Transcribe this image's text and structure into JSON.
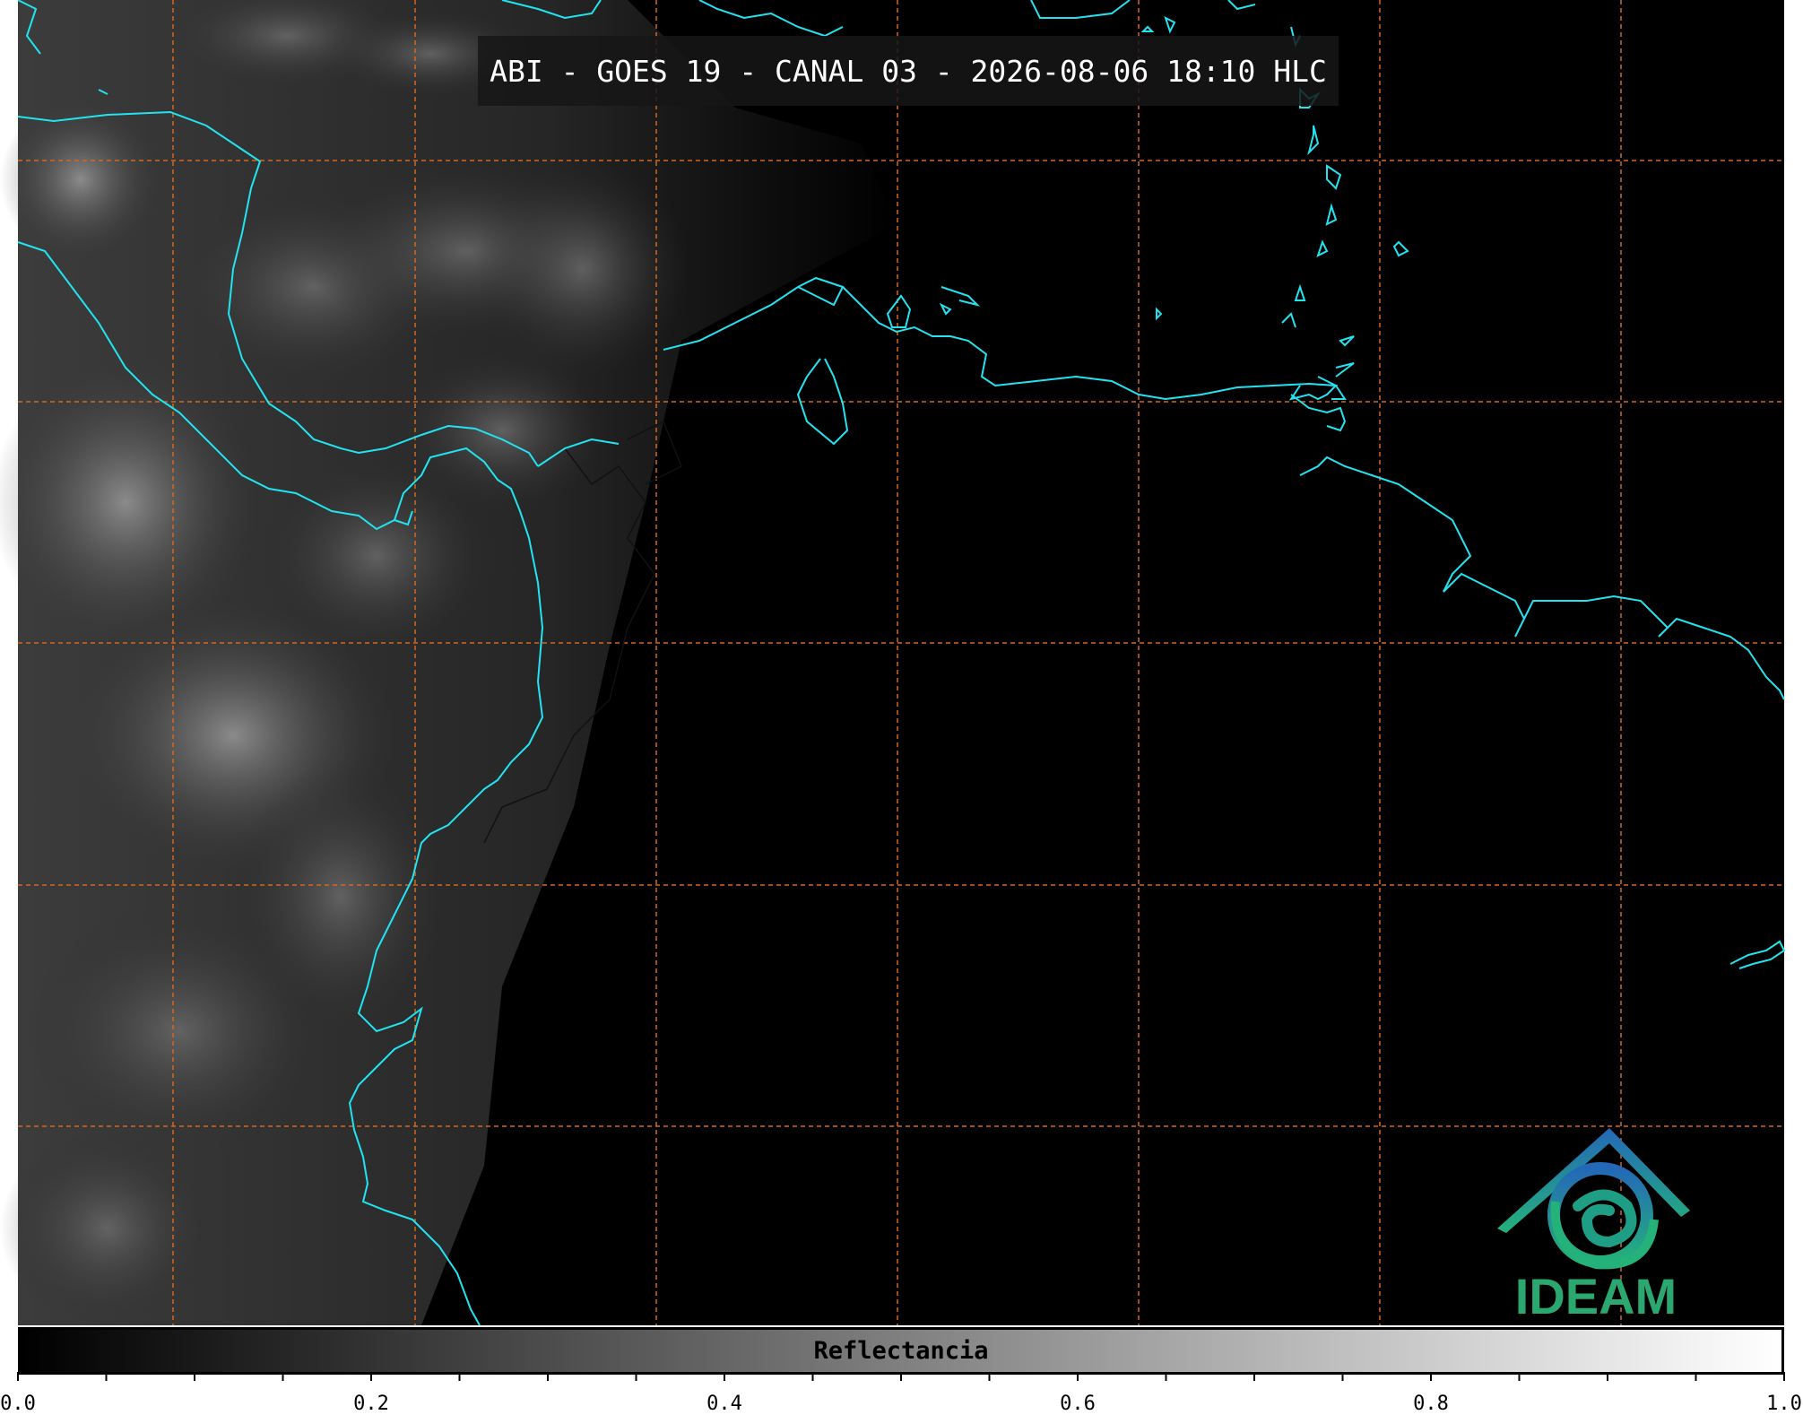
{
  "title": "ABI - GOES 19 - CANAL 03 - 2026-08-06 18:10 HLC",
  "colorbar": {
    "label": "Reflectancia",
    "ticks": [
      "0.0",
      "0.2",
      "0.4",
      "0.6",
      "0.8",
      "1.0"
    ],
    "range": [
      0.0,
      1.0
    ],
    "colormap": [
      "#000000",
      "#ffffff"
    ]
  },
  "logo": {
    "text": "IDEAM",
    "color": "#2aa86f",
    "accent": "#2478b5"
  },
  "colors": {
    "coastline": "#22e4f0",
    "gridline": "#d2691e",
    "borders": "#000000"
  },
  "icons": [
    "ideam-logo-icon"
  ]
}
